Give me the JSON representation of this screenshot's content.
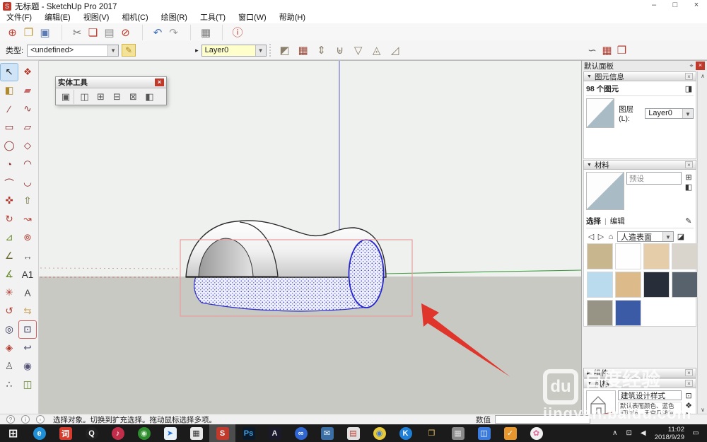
{
  "window": {
    "title": "无标题 - SketchUp Pro 2017",
    "minimize": "–",
    "maximize": "□",
    "close": "×",
    "app_glyph": "S"
  },
  "menu": {
    "items": [
      {
        "label": "文件(F)"
      },
      {
        "label": "编辑(E)"
      },
      {
        "label": "视图(V)"
      },
      {
        "label": "相机(C)"
      },
      {
        "label": "绘图(R)"
      },
      {
        "label": "工具(T)"
      },
      {
        "label": "窗口(W)"
      },
      {
        "label": "帮助(H)"
      }
    ]
  },
  "toolbar_main": {
    "buttons": [
      {
        "name": "new-button",
        "glyph": "⊕",
        "c": "#c0392b",
        "cls": ""
      },
      {
        "name": "open-button",
        "glyph": "❐",
        "c": "#c09a3e",
        "cls": ""
      },
      {
        "name": "save-button",
        "glyph": "▣",
        "c": "#5a7bb5",
        "cls": ""
      },
      {
        "name": "cut-button",
        "glyph": "✂",
        "c": "#777777",
        "cls": "gap"
      },
      {
        "name": "copy-button",
        "glyph": "❏",
        "c": "#c0392b",
        "cls": ""
      },
      {
        "name": "paste-button",
        "glyph": "▤",
        "c": "#8a8a8a",
        "cls": ""
      },
      {
        "name": "erase-button",
        "glyph": "⊘",
        "c": "#c0392b",
        "cls": ""
      },
      {
        "name": "undo-button",
        "glyph": "↶",
        "c": "#3e6db5",
        "cls": "gap"
      },
      {
        "name": "redo-button",
        "glyph": "↷",
        "c": "#9a9a9a",
        "cls": ""
      },
      {
        "name": "print-button",
        "glyph": "▦",
        "c": "#777777",
        "cls": "gap"
      },
      {
        "name": "model-info-button",
        "glyph": "ⓘ",
        "c": "#c0392b",
        "cls": "gap"
      }
    ]
  },
  "toolbar_second": {
    "type_label": "类型:",
    "type_value": "<undefined>",
    "dropdown_glyph": "▼",
    "classifier_edit_glyph": "✎",
    "layer_cursor_glyph": "▸",
    "layer_value": "Layer0",
    "sandbox_buttons": [
      {
        "name": "from-contours-button",
        "glyph": "◩",
        "c": "#8a7f6a"
      },
      {
        "name": "from-scratch-button",
        "glyph": "▦",
        "c": "#9a4a3a"
      },
      {
        "name": "smoove-button",
        "glyph": "⇕",
        "c": "#8a7f6a"
      },
      {
        "name": "stamp-button",
        "glyph": "⊎",
        "c": "#8a7f6a"
      },
      {
        "name": "drape-button",
        "glyph": "▽",
        "c": "#8a7f6a"
      },
      {
        "name": "add-detail-button",
        "glyph": "◬",
        "c": "#8a7f6a"
      },
      {
        "name": "flip-edge-button",
        "glyph": "◿",
        "c": "#8a7f6a"
      }
    ],
    "right_buttons": [
      {
        "name": "lasso-icon",
        "glyph": "∽",
        "c": "#666666"
      },
      {
        "name": "red-toolbar-icon-1",
        "glyph": "▦",
        "c": "#b03a2e"
      },
      {
        "name": "red-toolbar-icon-2",
        "glyph": "❒",
        "c": "#b03a2e"
      }
    ]
  },
  "solid_tools": {
    "title": "实体工具",
    "close": "×",
    "buttons": [
      {
        "name": "outer-shell-button",
        "glyph": "▣",
        "cls": "first"
      },
      {
        "name": "intersect-button",
        "glyph": "◫",
        "cls": ""
      },
      {
        "name": "union-button",
        "glyph": "⊞",
        "cls": ""
      },
      {
        "name": "subtract-button",
        "glyph": "⊟",
        "cls": ""
      },
      {
        "name": "trim-button",
        "glyph": "⊠",
        "cls": ""
      },
      {
        "name": "split-button",
        "glyph": "◧",
        "cls": ""
      }
    ]
  },
  "left_tools": {
    "items": [
      {
        "name": "select-tool",
        "glyph": "↖",
        "c": "#1a1a1a",
        "cls": "active"
      },
      {
        "name": "make-component-tool",
        "glyph": "❖",
        "c": "#b03a2e",
        "cls": ""
      },
      {
        "name": "paint-bucket-tool",
        "glyph": "◧",
        "c": "#b08a2e",
        "cls": ""
      },
      {
        "name": "eraser-tool",
        "glyph": "▰",
        "c": "#c96a6a",
        "cls": ""
      },
      {
        "name": "line-tool",
        "glyph": "∕",
        "c": "#8a2e2e",
        "cls": ""
      },
      {
        "name": "freehand-tool",
        "glyph": "∿",
        "c": "#8a2e2e",
        "cls": ""
      },
      {
        "name": "rectangle-tool",
        "glyph": "▭",
        "c": "#8a2e2e",
        "cls": ""
      },
      {
        "name": "rotated-rectangle-tool",
        "glyph": "▱",
        "c": "#8a2e2e",
        "cls": ""
      },
      {
        "name": "circle-tool",
        "glyph": "◯",
        "c": "#8a2e2e",
        "cls": ""
      },
      {
        "name": "polygon-tool",
        "glyph": "◇",
        "c": "#8a2e2e",
        "cls": ""
      },
      {
        "name": "pie-tool",
        "glyph": "◔",
        "c": "#8a2e2e",
        "cls": ""
      },
      {
        "name": "arc-2pt-tool",
        "glyph": "◠",
        "c": "#8a2e2e",
        "cls": ""
      },
      {
        "name": "arc-tool",
        "glyph": "⌒",
        "c": "#8a2e2e",
        "cls": ""
      },
      {
        "name": "arc-3pt-tool",
        "glyph": "◡",
        "c": "#8a2e2e",
        "cls": ""
      },
      {
        "name": "move-tool",
        "glyph": "✜",
        "c": "#b03a2e",
        "cls": ""
      },
      {
        "name": "push-pull-tool",
        "glyph": "⇧",
        "c": "#6a6a2e",
        "cls": ""
      },
      {
        "name": "rotate-tool",
        "glyph": "↻",
        "c": "#b03a2e",
        "cls": ""
      },
      {
        "name": "follow-me-tool",
        "glyph": "↝",
        "c": "#b03a2e",
        "cls": ""
      },
      {
        "name": "scale-tool",
        "glyph": "⊿",
        "c": "#6a8a2e",
        "cls": ""
      },
      {
        "name": "offset-tool",
        "glyph": "⊚",
        "c": "#b03a2e",
        "cls": ""
      },
      {
        "name": "tape-measure-tool",
        "glyph": "∠",
        "c": "#6a6a2e",
        "cls": ""
      },
      {
        "name": "dimension-tool",
        "glyph": "↔",
        "c": "#555555",
        "cls": ""
      },
      {
        "name": "protractor-tool",
        "glyph": "∡",
        "c": "#6a8a2e",
        "cls": ""
      },
      {
        "name": "text-tool",
        "glyph": "A1",
        "c": "#333333",
        "cls": ""
      },
      {
        "name": "axes-tool",
        "glyph": "✳",
        "c": "#b03a2e",
        "cls": ""
      },
      {
        "name": "3d-text-tool",
        "glyph": "A",
        "c": "#444444",
        "cls": ""
      },
      {
        "name": "orbit-tool",
        "glyph": "↺",
        "c": "#b03a2e",
        "cls": ""
      },
      {
        "name": "pan-tool",
        "glyph": "⇆",
        "c": "#c9a96a",
        "cls": ""
      },
      {
        "name": "zoom-tool",
        "glyph": "◎",
        "c": "#333355",
        "cls": ""
      },
      {
        "name": "zoom-window-tool",
        "glyph": "⊡",
        "c": "#333355",
        "cls": "outlined"
      },
      {
        "name": "zoom-extents-tool",
        "glyph": "◈",
        "c": "#b03a2e",
        "cls": ""
      },
      {
        "name": "previous-view-tool",
        "glyph": "↩",
        "c": "#555577",
        "cls": ""
      },
      {
        "name": "position-camera-tool",
        "glyph": "♙",
        "c": "#555555",
        "cls": ""
      },
      {
        "name": "look-around-tool",
        "glyph": "◉",
        "c": "#555577",
        "cls": ""
      },
      {
        "name": "walk-tool",
        "glyph": "∴",
        "c": "#333333",
        "cls": ""
      },
      {
        "name": "section-plane-tool",
        "glyph": "◫",
        "c": "#6a8a2e",
        "cls": ""
      }
    ]
  },
  "panel": {
    "title": "默认面板",
    "pin_glyph": "⌖",
    "close_glyph": "×",
    "scroll_up_glyph": "∧",
    "scroll_down_glyph": "∨",
    "entity_info": {
      "header": "图元信息",
      "arrow": "▼",
      "close": "×",
      "count": "98 个图元",
      "detach_glyph": "◨",
      "layer_label": "图层(L):",
      "layer_value": "Layer0",
      "dropdown_glyph": "▼"
    },
    "materials": {
      "header": "材料",
      "arrow": "▼",
      "close": "×",
      "name_value": "预设",
      "create_glyph": "⊞",
      "set_current_glyph": "◧",
      "tab_select": "选择",
      "tab_divider": "|",
      "tab_edit": "编辑",
      "eyedropper_glyph": "✎",
      "back_glyph": "◁",
      "forward_glyph": "▷",
      "home_glyph": "⌂",
      "collection_value": "人造表面",
      "dropdown_glyph": "▼",
      "sample_paint_glyph": "◪",
      "swatches": [
        "#c7b68e",
        "#fefefe",
        "#e6cda9",
        "#d9d5cc",
        "#badbee",
        "#dcba8a",
        "#272e3a",
        "#57626d",
        "#989485",
        "#3c5ba6"
      ]
    },
    "components": {
      "header": "组件",
      "arrow": "▶",
      "close": "×"
    },
    "styles": {
      "header": "风格",
      "arrow": "▼",
      "close": "×",
      "name_value": "建筑设计样式",
      "description": "默认表面颜色、蓝色调边线、天空且浅灰色背景颜色。",
      "monitor_glyph": "⊡",
      "update_glyph": "❖",
      "refresh_glyph": "↻",
      "chevron_glyph": "∨"
    }
  },
  "statusbar": {
    "icons": [
      {
        "name": "geolocation-icon",
        "glyph": "?"
      },
      {
        "name": "credits-icon",
        "glyph": "i"
      },
      {
        "name": "help-icon",
        "glyph": "◦"
      }
    ],
    "message": "选择对象。切换到扩充选择。拖动鼠标选择多项。",
    "measure_label": "数值",
    "measure_value": ""
  },
  "taskbar": {
    "items": [
      {
        "name": "start-button",
        "glyph": "⊞",
        "bg": "transparent",
        "fg": "#ffffff",
        "cls": "start"
      },
      {
        "name": "browser-blue-app",
        "glyph": "e",
        "bg": "#1f8fd6",
        "fg": "#ffffff",
        "shape": "circle",
        "cls": ""
      },
      {
        "name": "youdao-app",
        "glyph": "词",
        "bg": "#d63c2e",
        "fg": "#ffffff",
        "cls": ""
      },
      {
        "name": "qq-app",
        "glyph": "Q",
        "bg": "#222222",
        "fg": "#ffffff",
        "shape": "circle",
        "cls": ""
      },
      {
        "name": "music-app",
        "glyph": "♪",
        "bg": "#c22e4a",
        "fg": "#ffffff",
        "shape": "circle",
        "cls": ""
      },
      {
        "name": "earth-app",
        "glyph": "◉",
        "bg": "#2e8b2e",
        "fg": "#cfeecc",
        "shape": "circle",
        "cls": ""
      },
      {
        "name": "thunder-app",
        "glyph": "➤",
        "bg": "#e8f0f8",
        "fg": "#1f6fd6",
        "cls": ""
      },
      {
        "name": "calculator-app",
        "glyph": "▦",
        "bg": "#e8e8e8",
        "fg": "#333333",
        "cls": ""
      },
      {
        "name": "sketchup-app",
        "glyph": "S",
        "bg": "#c0392b",
        "fg": "#ffffff",
        "cls": "active"
      },
      {
        "name": "photoshop-app",
        "glyph": "Ps",
        "bg": "#0a1a2a",
        "fg": "#4aa3e0",
        "cls": ""
      },
      {
        "name": "illustrator-like-app",
        "glyph": "A",
        "bg": "#1a1a2a",
        "fg": "#e0e0e8",
        "cls": ""
      },
      {
        "name": "baidu-disk-app",
        "glyph": "∞",
        "bg": "#2f66d0",
        "fg": "#ffffff",
        "shape": "circle",
        "cls": ""
      },
      {
        "name": "mail-app",
        "glyph": "✉",
        "bg": "#3a6ea5",
        "fg": "#ffffff",
        "cls": ""
      },
      {
        "name": "winrar-app",
        "glyph": "▤",
        "bg": "#e0e0e0",
        "fg": "#b03a2e",
        "cls": ""
      },
      {
        "name": "chrome-app",
        "glyph": "◉",
        "bg": "#e8c93a",
        "fg": "#3a7be0",
        "shape": "circle",
        "cls": ""
      },
      {
        "name": "kugou-app",
        "glyph": "K",
        "bg": "#1f7fd6",
        "fg": "#ffffff",
        "shape": "circle",
        "cls": ""
      },
      {
        "name": "file-explorer",
        "glyph": "❒",
        "bg": "transparent",
        "fg": "#f0c05a",
        "cls": ""
      },
      {
        "name": "gray-app",
        "glyph": "▦",
        "bg": "#8a8a8a",
        "fg": "#dddddd",
        "cls": ""
      },
      {
        "name": "blue-box-app",
        "glyph": "◫",
        "bg": "#3a7be0",
        "fg": "#ffffff",
        "cls": ""
      },
      {
        "name": "security-app",
        "glyph": "✓",
        "bg": "#e8962e",
        "fg": "#ffffff",
        "cls": ""
      },
      {
        "name": "pink-app",
        "glyph": "✿",
        "bg": "#f0f0f0",
        "fg": "#e06a9a",
        "shape": "circle",
        "cls": ""
      }
    ],
    "tray": {
      "up_glyph": "∧",
      "display_glyph": "⊡",
      "speaker_glyph": "◀",
      "time": "11:02",
      "date": "2018/9/29",
      "notification_glyph": "▭"
    }
  },
  "watermark": {
    "logo_text": "du",
    "brand": "百度经验",
    "url": "jingyan.baidu.com"
  }
}
